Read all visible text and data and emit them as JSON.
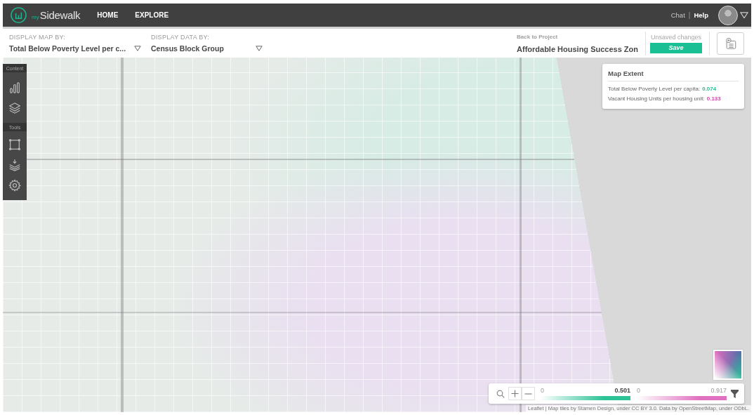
{
  "header": {
    "logo": {
      "prefix": "my",
      "name": "Sidewalk"
    },
    "nav": [
      "HOME",
      "EXPLORE"
    ],
    "links": [
      {
        "label": "Chat",
        "selected": false
      },
      {
        "label": "Help",
        "selected": true
      }
    ],
    "separator": "|"
  },
  "toolbar": {
    "selectors": [
      {
        "label": "DISPLAY MAP BY:",
        "value": "Total Below Poverty Level per c..."
      },
      {
        "label": "DISPLAY DATA BY:",
        "value": "Census Block Group"
      }
    ],
    "project": {
      "back_link": "Back to Project",
      "name": "Affordable Housing Success Zon"
    },
    "save": {
      "status": "Unsaved changes",
      "button": "Save"
    }
  },
  "map": {
    "side_panel": [
      {
        "title": "Content",
        "tools": [
          {
            "kind": "chart"
          },
          {
            "kind": "layers"
          }
        ]
      },
      {
        "title": "Tools",
        "tools": [
          {
            "kind": "select"
          },
          {
            "kind": "import"
          },
          {
            "kind": "settings"
          }
        ]
      }
    ],
    "map_extent": {
      "title": "Map Extent",
      "rows": [
        {
          "label": "Total Below Poverty Level per capita:",
          "value": "0.074",
          "color": "#1fbf94"
        },
        {
          "label": "Vacant Housing Units per housing unit:",
          "value": "0.133",
          "color": "#e03fb4"
        }
      ]
    },
    "legend": {
      "scales": [
        {
          "min": "0",
          "max": "0.501",
          "color": "#2ec397",
          "selected": true
        },
        {
          "min": "0",
          "max": "0.917",
          "color": "#e070c0",
          "selected": false
        }
      ]
    },
    "attribution": "Leaflet | Map tiles by Stamen Design, under CC BY 3.0. Data by OpenStreetMap, under ODbL."
  }
}
